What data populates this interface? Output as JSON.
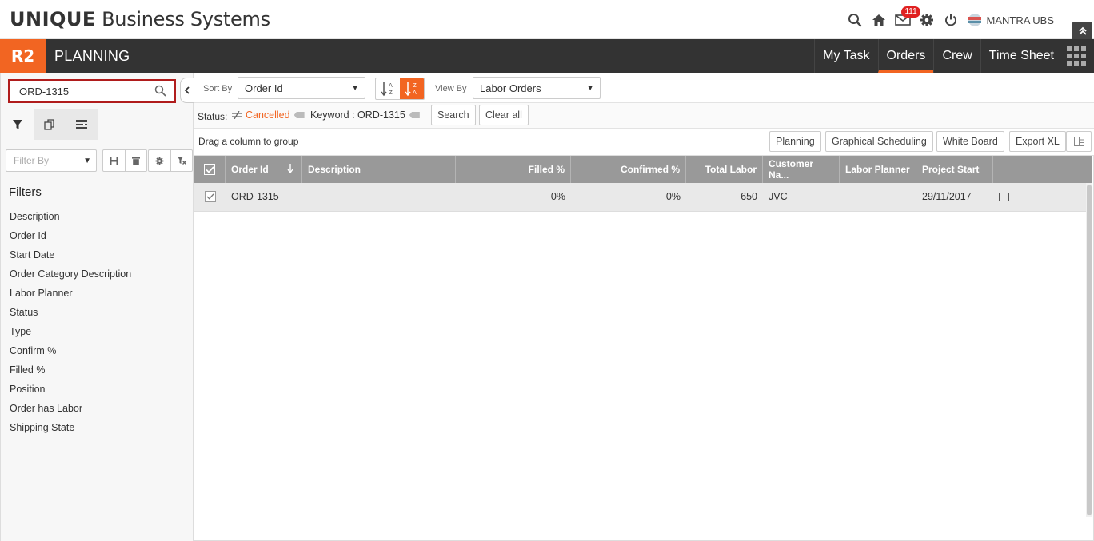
{
  "header": {
    "brand_bold": "UNIQUE",
    "brand_rest": " Business Systems",
    "notifications_count": "111",
    "user_name": "MANTRA UBS"
  },
  "navbar": {
    "logo": "R2",
    "module_title": "PLANNING",
    "tabs": [
      {
        "label": "My Task",
        "active": false
      },
      {
        "label": "Orders",
        "active": true
      },
      {
        "label": "Crew",
        "active": false
      },
      {
        "label": "Time Sheet",
        "active": false
      }
    ]
  },
  "left_panel": {
    "search_value": "ORD-1315",
    "filter_by_placeholder": "Filter By",
    "filters_heading": "Filters",
    "filters": [
      "Description",
      "Order Id",
      "Start Date",
      "Order Category Description",
      "Labor Planner",
      "Status",
      "Type",
      "Confirm %",
      "Filled %",
      "Position",
      "Order has Labor",
      "Shipping State"
    ]
  },
  "toolbar": {
    "sort_by_label": "Sort By",
    "sort_by_value": "Order Id",
    "view_by_label": "View By",
    "view_by_value": "Labor Orders",
    "status_label": "Status:",
    "status_chip": "Cancelled",
    "keyword_chip": "Keyword : ORD-1315",
    "search_button": "Search",
    "clear_all_button": "Clear all",
    "group_hint": "Drag a column to group",
    "planning_button": "Planning",
    "graphical_scheduling_button": "Graphical Scheduling",
    "white_board_button": "White Board",
    "export_xl_button": "Export XL"
  },
  "grid": {
    "columns": [
      "Order Id",
      "Description",
      "Filled %",
      "Confirmed %",
      "Total Labor",
      "Customer Na...",
      "Labor Planner",
      "Project Start"
    ],
    "rows": [
      {
        "order_id": "ORD-1315",
        "description": "",
        "filled": "0%",
        "confirmed": "0%",
        "total_labor": "650",
        "customer": "JVC",
        "labor_planner": "",
        "project_start": "29/11/2017"
      }
    ]
  },
  "colors": {
    "accent": "#f26522",
    "navbar": "#333333",
    "grid_header": "#999999",
    "badge": "#e02020",
    "search_border": "#b01c1c"
  }
}
